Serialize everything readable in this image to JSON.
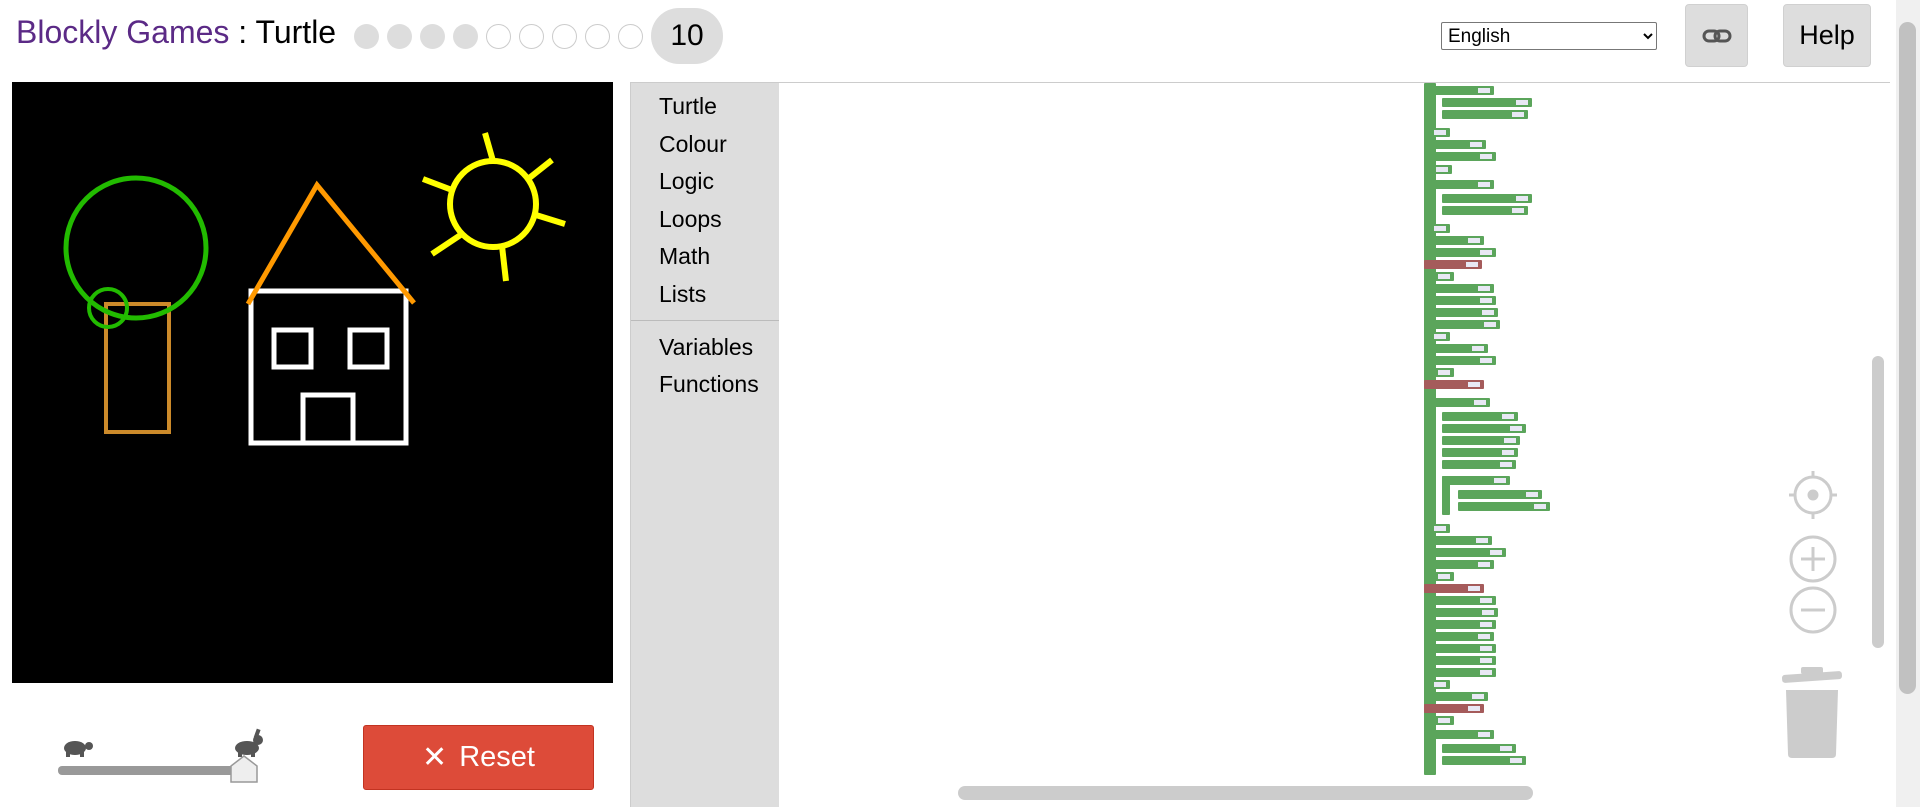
{
  "header": {
    "app_name": "Blockly Games",
    "separator": " : ",
    "game_name": "Turtle",
    "levels_done": 4,
    "levels_todo": 5,
    "current_level": "10",
    "language": "English",
    "language_options": [
      "English"
    ],
    "help_label": "Help",
    "link_icon": "link-icon"
  },
  "controls": {
    "reset_label": "Reset",
    "speed_slow_icon": "turtle-icon",
    "speed_fast_icon": "rabbit-icon",
    "speed_value": 1.0
  },
  "toolbox": {
    "categories": [
      "Turtle",
      "Colour",
      "Logic",
      "Loops",
      "Math",
      "Lists"
    ],
    "categories2": [
      "Variables",
      "Functions"
    ]
  },
  "workspace": {
    "icons": [
      "recenter-icon",
      "zoom-in-icon",
      "zoom-out-icon",
      "trash-icon"
    ]
  },
  "colors": {
    "tree_canopy": "#22bb00",
    "tree_trunk": "#cc8a2a",
    "roof": "#ff9900",
    "house": "#ffffff",
    "sun": "#ffff00",
    "reset": "#dd4b39",
    "block_green": "#5ba55b",
    "block_red": "#a55b5b"
  }
}
